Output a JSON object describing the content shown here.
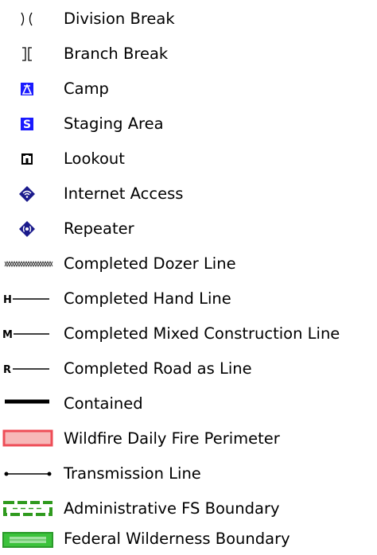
{
  "legend": {
    "items": [
      {
        "label": "Division Break",
        "icon": "division-break-symbol"
      },
      {
        "label": "Branch Break",
        "icon": "branch-break-symbol"
      },
      {
        "label": "Camp",
        "icon": "camp-tent-icon",
        "color": "#1a1aff"
      },
      {
        "label": "Staging Area",
        "icon": "staging-area-icon",
        "glyph": "S",
        "color": "#1a1aff"
      },
      {
        "label": "Lookout",
        "icon": "lookout-binoculars-icon"
      },
      {
        "label": "Internet Access",
        "icon": "internet-access-icon",
        "color": "#1a1a8c"
      },
      {
        "label": "Repeater",
        "icon": "repeater-icon",
        "color": "#1a1a8c"
      },
      {
        "label": "Completed Dozer Line",
        "icon": "dozer-line-symbol"
      },
      {
        "label": "Completed Hand Line",
        "icon": "hand-line-symbol",
        "glyph": "H"
      },
      {
        "label": "Completed Mixed Construction Line",
        "icon": "mixed-construction-line-symbol",
        "glyph": "M"
      },
      {
        "label": "Completed Road as Line",
        "icon": "road-as-line-symbol",
        "glyph": "R"
      },
      {
        "label": "Contained",
        "icon": "contained-line-symbol"
      },
      {
        "label": "Wildfire Daily Fire Perimeter",
        "icon": "fire-perimeter-swatch",
        "fill": "#f7b8b8",
        "stroke": "#ee4d57"
      },
      {
        "label": "Transmission Line",
        "icon": "transmission-line-symbol"
      },
      {
        "label": "Administrative FS Boundary",
        "icon": "fs-boundary-swatch",
        "color": "#2f9a1e"
      },
      {
        "label": "Federal Wilderness Boundary",
        "icon": "wilderness-boundary-swatch",
        "color": "#3cc23c"
      }
    ]
  }
}
